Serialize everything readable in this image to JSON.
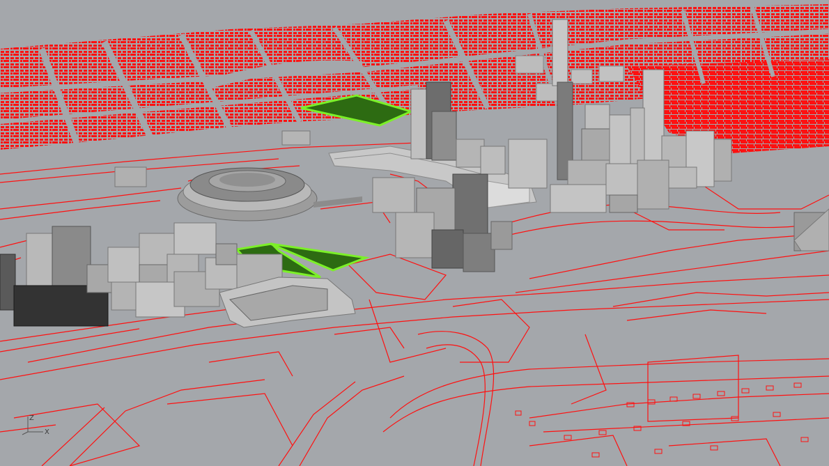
{
  "viewport": {
    "background_color": "#a4a7ab",
    "ground_color": "#a4a7ab"
  },
  "colors": {
    "curves": "#ff1010",
    "selected_fill": "#2d6b12",
    "selected_outline": "#7cf028",
    "building_light": "#bdbdbd",
    "building_mid": "#9a9a9a",
    "building_dark": "#4a4a4a",
    "building_black": "#2a2a2a"
  },
  "axes": {
    "z_label": "Z",
    "x_label": "X",
    "icon": "world-axes-icon"
  }
}
